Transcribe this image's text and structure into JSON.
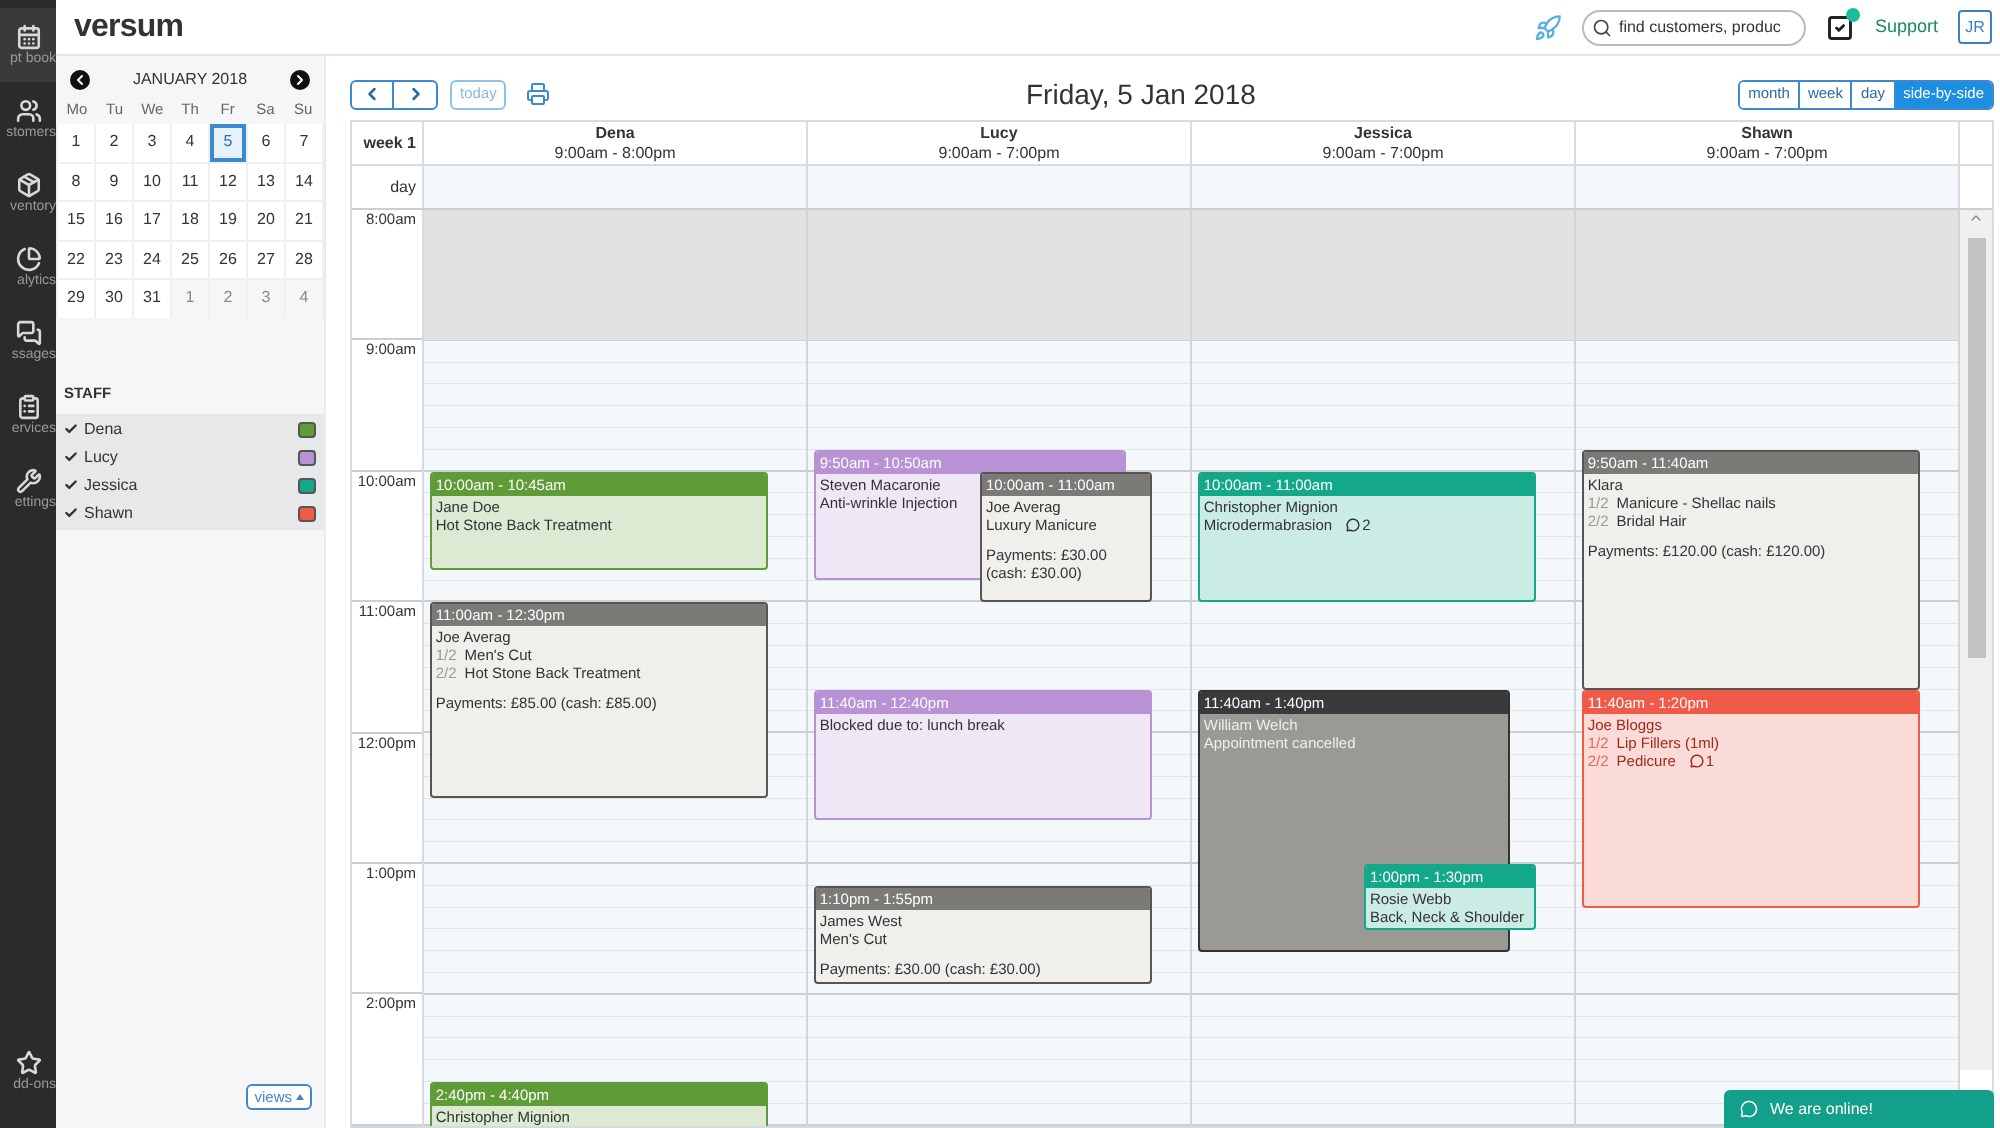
{
  "rail": [
    {
      "label": "pt book",
      "selected": true
    },
    {
      "label": "stomers",
      "selected": false
    },
    {
      "label": "ventory",
      "selected": false
    },
    {
      "label": "alytics",
      "selected": false
    },
    {
      "label": "ssages",
      "selected": false
    },
    {
      "label": "ervices",
      "selected": false
    },
    {
      "label": "ettings",
      "selected": false
    },
    {
      "label": "dd-ons",
      "selected": false
    }
  ],
  "header": {
    "logo": "versum",
    "search": {
      "placeholder": "find customers, produc"
    },
    "support": "Support",
    "user": "JR"
  },
  "mini_calendar": {
    "month": "JANUARY 2018",
    "weekdays": [
      "Mo",
      "Tu",
      "We",
      "Th",
      "Fr",
      "Sa",
      "Su"
    ],
    "weeks": [
      [
        {
          "day": "1",
          "muted": false,
          "selected": false
        },
        {
          "day": "2",
          "muted": false,
          "selected": false
        },
        {
          "day": "3",
          "muted": false,
          "selected": false
        },
        {
          "day": "4",
          "muted": false,
          "selected": false
        },
        {
          "day": "5",
          "muted": false,
          "selected": true
        },
        {
          "day": "6",
          "muted": false,
          "selected": false
        },
        {
          "day": "7",
          "muted": false,
          "selected": false
        }
      ],
      [
        {
          "day": "8",
          "muted": false,
          "selected": false
        },
        {
          "day": "9",
          "muted": false,
          "selected": false
        },
        {
          "day": "10",
          "muted": false,
          "selected": false
        },
        {
          "day": "11",
          "muted": false,
          "selected": false
        },
        {
          "day": "12",
          "muted": false,
          "selected": false
        },
        {
          "day": "13",
          "muted": false,
          "selected": false
        },
        {
          "day": "14",
          "muted": false,
          "selected": false
        }
      ],
      [
        {
          "day": "15",
          "muted": false,
          "selected": false
        },
        {
          "day": "16",
          "muted": false,
          "selected": false
        },
        {
          "day": "17",
          "muted": false,
          "selected": false
        },
        {
          "day": "18",
          "muted": false,
          "selected": false
        },
        {
          "day": "19",
          "muted": false,
          "selected": false
        },
        {
          "day": "20",
          "muted": false,
          "selected": false
        },
        {
          "day": "21",
          "muted": false,
          "selected": false
        }
      ],
      [
        {
          "day": "22",
          "muted": false,
          "selected": false
        },
        {
          "day": "23",
          "muted": false,
          "selected": false
        },
        {
          "day": "24",
          "muted": false,
          "selected": false
        },
        {
          "day": "25",
          "muted": false,
          "selected": false
        },
        {
          "day": "26",
          "muted": false,
          "selected": false
        },
        {
          "day": "27",
          "muted": false,
          "selected": false
        },
        {
          "day": "28",
          "muted": false,
          "selected": false
        }
      ],
      [
        {
          "day": "29",
          "muted": false,
          "selected": false
        },
        {
          "day": "30",
          "muted": false,
          "selected": false
        },
        {
          "day": "31",
          "muted": false,
          "selected": false
        },
        {
          "day": "1",
          "muted": true,
          "selected": false
        },
        {
          "day": "2",
          "muted": true,
          "selected": false
        },
        {
          "day": "3",
          "muted": true,
          "selected": false
        },
        {
          "day": "4",
          "muted": true,
          "selected": false
        }
      ]
    ]
  },
  "staff_panel": {
    "title": "STAFF",
    "members": [
      {
        "name": "Dena",
        "checked": true,
        "color": "#5f9b36"
      },
      {
        "name": "Lucy",
        "checked": true,
        "color": "#b992d6"
      },
      {
        "name": "Jessica",
        "checked": true,
        "color": "#14a88a"
      },
      {
        "name": "Shawn",
        "checked": true,
        "color": "#ef5b48"
      }
    ],
    "views_button": "views"
  },
  "toolbar": {
    "today": "today",
    "title": "Friday, 5 Jan 2018",
    "views": [
      {
        "label": "month",
        "selected": false
      },
      {
        "label": "week",
        "selected": false
      },
      {
        "label": "day",
        "selected": false
      },
      {
        "label": "side-by-side",
        "selected": true
      }
    ]
  },
  "grid": {
    "week_label": "week 1",
    "day_label": "day",
    "times": [
      "8:00am",
      "9:00am",
      "10:00am",
      "11:00am",
      "12:00pm",
      "1:00pm",
      "2:00pm"
    ],
    "columns": [
      {
        "name": "Dena",
        "hours": "9:00am - 8:00pm",
        "events": [
          {
            "kind": "booked",
            "time": "10:00am - 10:45am",
            "client": "Jane Doe",
            "services": [
              {
                "name": "Hot Stone Back Treatment"
              }
            ]
          },
          {
            "kind": "paid",
            "time": "11:00am - 12:30pm",
            "client": "Joe Averag",
            "services": [
              {
                "num": "1/2",
                "name": "Men's Cut"
              },
              {
                "num": "2/2",
                "name": "Hot Stone Back Treatment"
              }
            ],
            "payment": "Payments: £85.00 (cash: £85.00)"
          },
          {
            "kind": "booked",
            "time": "2:40pm - 4:40pm",
            "client": "Christopher Mignion"
          }
        ]
      },
      {
        "name": "Lucy",
        "hours": "9:00am - 7:00pm",
        "events": [
          {
            "kind": "booked",
            "time": "9:50am - 10:50am",
            "client": "Steven Macaronie",
            "services": [
              {
                "name": "Anti-wrinkle Injection"
              }
            ]
          },
          {
            "kind": "paid",
            "time": "10:00am - 11:00am",
            "client": "Joe Averag",
            "services": [
              {
                "name": "Luxury Manicure"
              }
            ],
            "payment": "Payments: £30.00 (cash: £30.00)"
          },
          {
            "kind": "booked",
            "time": "11:40am - 12:40pm",
            "client": "Blocked due to: lunch break"
          },
          {
            "kind": "paid",
            "time": "1:10pm - 1:55pm",
            "client": "James West",
            "services": [
              {
                "name": "Men's Cut"
              }
            ],
            "payment": "Payments: £30.00 (cash: £30.00)"
          }
        ]
      },
      {
        "name": "Jessica",
        "hours": "9:00am - 7:00pm",
        "events": [
          {
            "kind": "booked",
            "time": "10:00am - 11:00am",
            "client": "Christopher Mignion",
            "services": [
              {
                "name": "Microdermabrasion",
                "badge": "2"
              }
            ]
          },
          {
            "kind": "cancelled",
            "time": "11:40am - 1:40pm",
            "client": "William Welch",
            "note": "Appointment cancelled"
          },
          {
            "kind": "booked",
            "time": "1:00pm - 1:30pm",
            "client": "Rosie Webb",
            "services": [
              {
                "name": "Back, Neck & Shoulder"
              }
            ]
          }
        ]
      },
      {
        "name": "Shawn",
        "hours": "9:00am - 7:00pm",
        "events": [
          {
            "kind": "paid",
            "time": "9:50am - 11:40am",
            "client": "Klara",
            "services": [
              {
                "num": "1/2",
                "name": "Manicure - Shellac nails"
              },
              {
                "num": "2/2",
                "name": "Bridal Hair"
              }
            ],
            "payment": "Payments: £120.00 (cash: £120.00)"
          },
          {
            "kind": "booked",
            "time": "11:40am - 1:20pm",
            "client": "Joe Bloggs",
            "services": [
              {
                "num": "1/2",
                "name": "Lip Fillers (1ml)"
              },
              {
                "num": "2/2",
                "name": "Pedicure",
                "badge": "1"
              }
            ]
          }
        ]
      }
    ]
  },
  "chat": {
    "label": "We are online!"
  }
}
